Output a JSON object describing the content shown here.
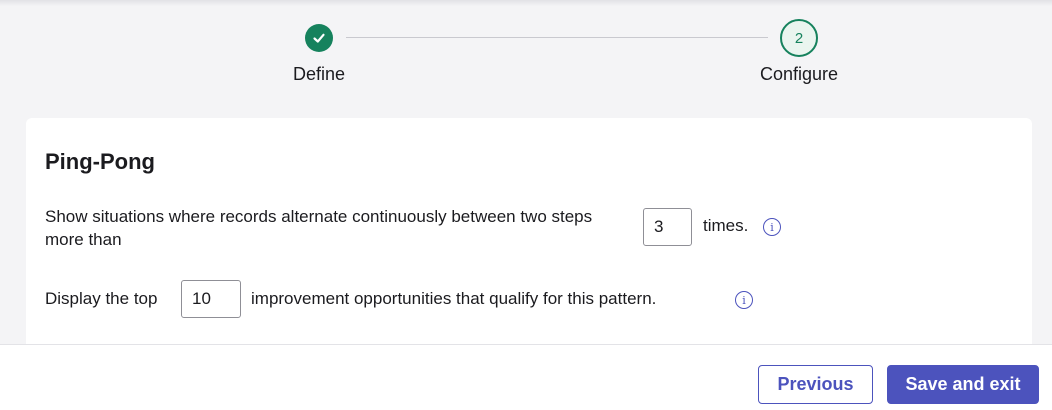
{
  "stepper": {
    "steps": [
      {
        "label": "Define",
        "status": "complete"
      },
      {
        "label": "Configure",
        "number": "2",
        "status": "current"
      }
    ]
  },
  "card": {
    "title": "Ping-Pong",
    "row1": {
      "text": "Show situations where records alternate continuously between two steps more than",
      "value": "3",
      "suffix": "times."
    },
    "row2": {
      "prefix": "Display the top",
      "value": "10",
      "suffix": "improvement opportunities that qualify for this pattern."
    },
    "info_icon_glyph": "i"
  },
  "footer": {
    "previous_label": "Previous",
    "save_label": "Save and exit"
  },
  "colors": {
    "success": "#16825d",
    "primary": "#4c53bd"
  }
}
